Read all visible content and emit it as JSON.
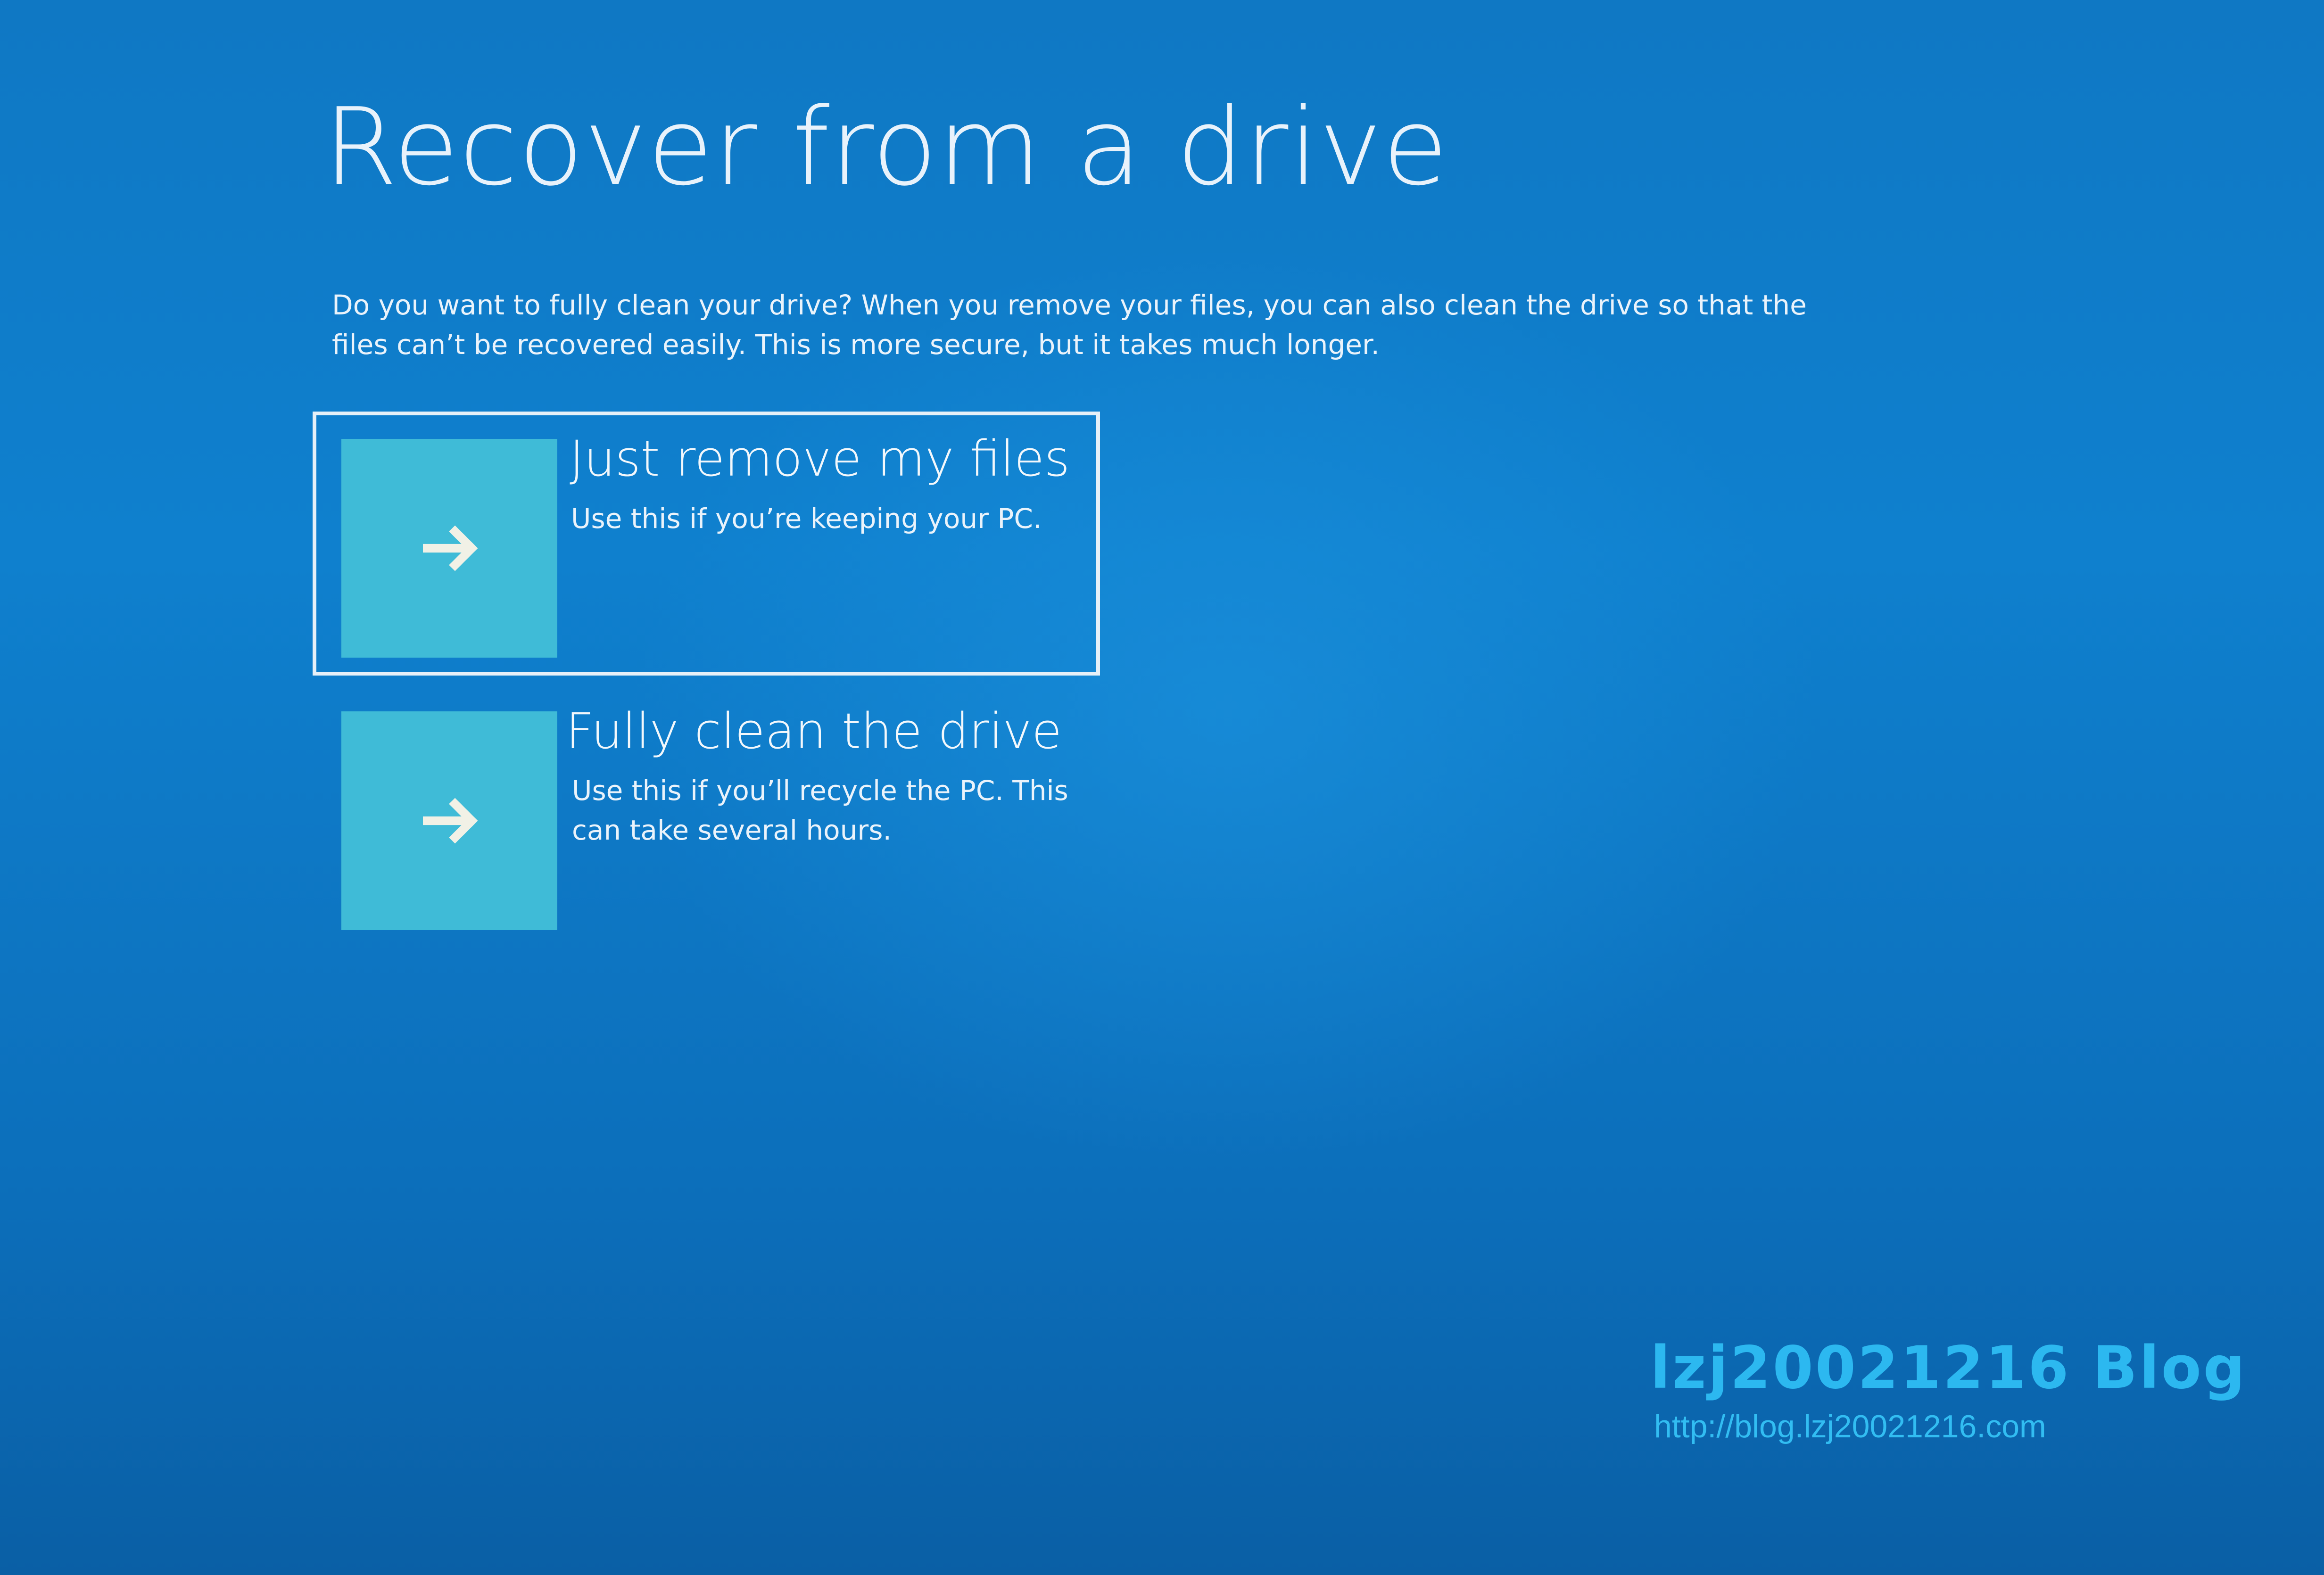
{
  "page": {
    "title": "Recover from a drive",
    "description": "Do you want to fully clean your drive? When you remove your files, you can also clean the drive so that the files can’t be recovered easily. This is more secure, but it takes much longer."
  },
  "options": [
    {
      "icon": "arrow-right-icon",
      "label": "Just remove my files",
      "description": "Use this if you’re keeping your PC.",
      "selected": true
    },
    {
      "icon": "arrow-right-icon",
      "label": "Fully clean the drive",
      "description": "Use this if you’ll recycle the PC. This can take several hours.",
      "selected": false
    }
  ],
  "watermark": {
    "title": "lzj20021216 Blog",
    "url": "http://blog.lzj20021216.com"
  },
  "colors": {
    "background": "#0f80ce",
    "tile": "#3fbbd7",
    "selection_border": "#e6f0f8",
    "watermark": "#2cb8f0"
  }
}
